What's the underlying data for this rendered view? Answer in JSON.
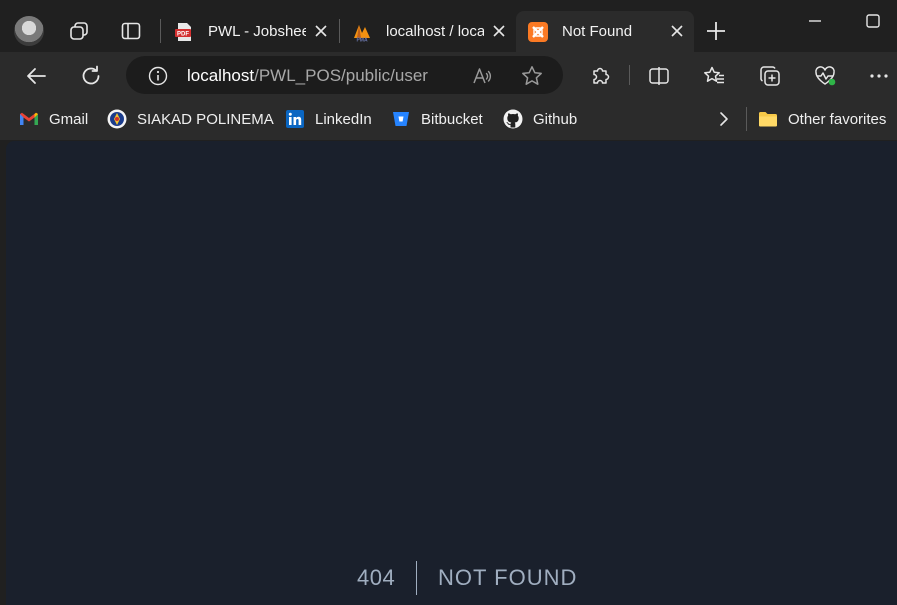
{
  "tabs": [
    {
      "title": "PWL - Jobshee",
      "icon": "pdf-icon"
    },
    {
      "title": "localhost / loca",
      "icon": "phpmyadmin-icon"
    },
    {
      "title": "Not Found",
      "icon": "xampp-icon"
    }
  ],
  "address_bar": {
    "host": "localhost",
    "path": "/PWL_POS/public/user"
  },
  "favorites": [
    {
      "label": "Gmail",
      "icon": "gmail-icon"
    },
    {
      "label": "SIAKAD POLINEMA",
      "icon": "polinema-icon"
    },
    {
      "label": "LinkedIn",
      "icon": "linkedin-icon"
    },
    {
      "label": "Bitbucket",
      "icon": "bitbucket-icon"
    },
    {
      "label": "Github",
      "icon": "github-icon"
    }
  ],
  "other_favorites": "Other favorites",
  "page": {
    "code": "404",
    "message": "NOT FOUND"
  },
  "colors": {
    "page_background": "#1a202c",
    "error_text": "#a0aec0",
    "chrome": "#2b2b2b"
  }
}
